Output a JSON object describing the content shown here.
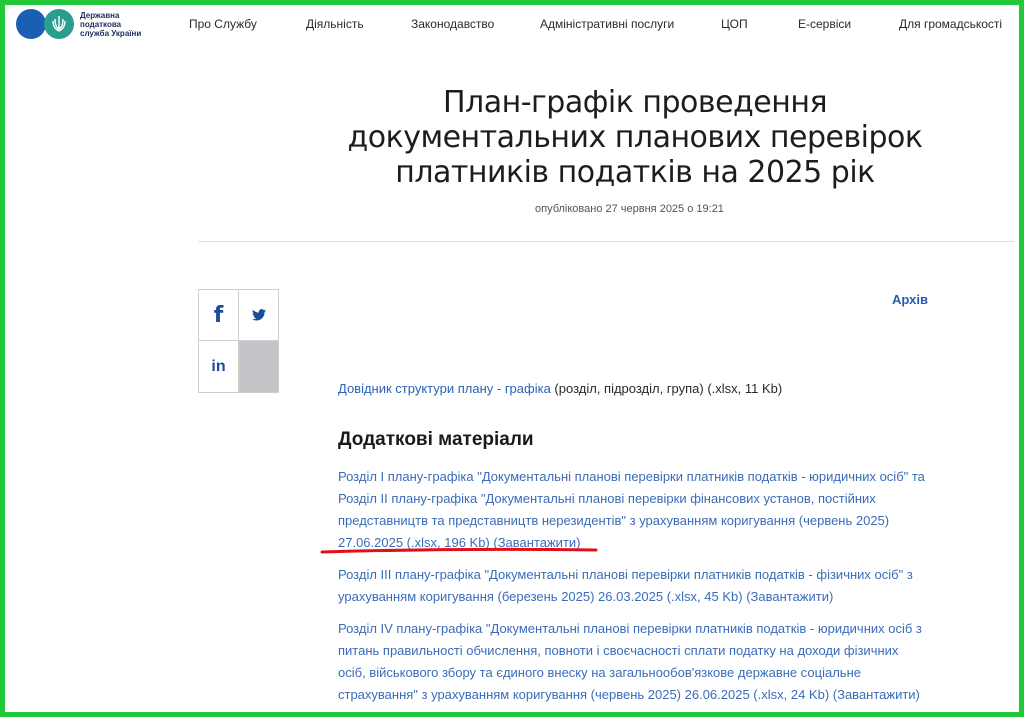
{
  "header": {
    "logo_text": "Державна податкова служба України",
    "nav": [
      "Про Службу",
      "Діяльність",
      "Законодавство",
      "Адміністративні послуги",
      "ЦОП",
      "Е-сервіси",
      "Для громадськості"
    ]
  },
  "article": {
    "title": "План-графік проведення документальних планових перевірок платників податків на 2025 рік",
    "published": "опубліковано 27 червня 2025 о 19:21"
  },
  "share": {
    "facebook": "f",
    "linkedin": "in",
    "twitter_icon": "twitter-bird-icon"
  },
  "archive_link": "Архів",
  "guide": {
    "link": "Довідник структури плану - графіка",
    "rest": " (розділ, підрозділ, група) (.xlsx, 11 Kb)"
  },
  "additional": {
    "heading": "Додаткові матеріали",
    "items": [
      {
        "lines": [
          "Розділ I плану-графіка \"Документальні планові перевірки платників податків - юридичних осіб\" та",
          "Розділ II плану-графіка \"Документальні планові перевірки фінансових установ, постійних",
          "представництв та представництв нерезидентів\" з урахуванням коригування (червень 2025)",
          "27.06.2025 (.xlsx, 196 Kb) (Завантажити)"
        ]
      },
      {
        "lines": [
          "Розділ III плану-графіка \"Документальні планові перевірки платників податків - фізичних осіб\" з",
          "урахуванням коригування (березень 2025) 26.03.2025 (.xlsx, 45 Kb) (Завантажити)"
        ]
      },
      {
        "lines": [
          "Розділ IV плану-графіка \"Документальні планові перевірки платників податків - юридичних осіб з",
          "питань правильності обчислення, повноти і своєчасності сплати податку на доходи фізичних",
          "осіб, військового збору та єдиного внеску на загальнообов'язкове державне соціальне",
          "страхування\" з урахуванням коригування (червень 2025) 26.06.2025 (.xlsx, 24 Kb) (Завантажити)"
        ]
      }
    ]
  },
  "colors": {
    "frame": "#22c83a",
    "link": "#3b6cb9",
    "underline": "#e0101a"
  }
}
